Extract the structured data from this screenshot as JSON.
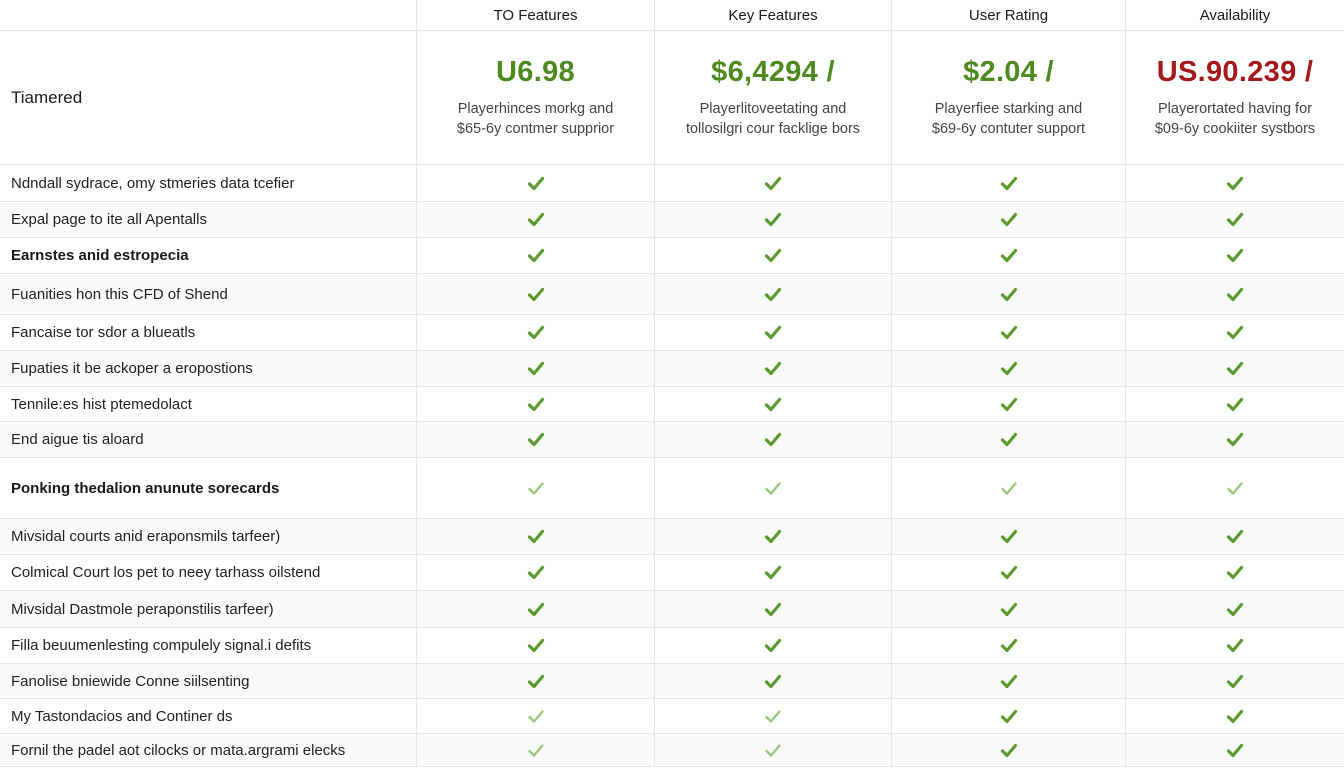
{
  "header": {
    "columns": [
      "TO Features",
      "Key Features",
      "User Rating",
      "Availability"
    ]
  },
  "plans": {
    "label": "Tiamered",
    "items": [
      {
        "price": "U6.98",
        "desc_line1": "Playerhinces morkg and",
        "desc_line2": "$65-6y contmer supprior",
        "price_color": "#4e8a1f"
      },
      {
        "price": "$6,4294 /",
        "desc_line1": "Playerlitoveetating and",
        "desc_line2": "tollosilgri cour facklige bors",
        "price_color": "#4e8a1f"
      },
      {
        "price": "$2.04 /",
        "desc_line1": "Playerfiee starking and",
        "desc_line2": "$69-6y contuter support",
        "price_color": "#4e8a1f"
      },
      {
        "price": "US.90.239 /",
        "desc_line1": "Playerortated having for",
        "desc_line2": "$09-6y cookiiter systbors",
        "price_color": "#a3191c"
      }
    ]
  },
  "check_icon": "check-icon",
  "features": [
    {
      "label": "Ndndall sydrace, omy stmeries data tcefier",
      "checks": [
        "dark",
        "dark",
        "dark",
        "dark"
      ]
    },
    {
      "label": "Expal page to ite all Apentalls",
      "checks": [
        "dark",
        "dark",
        "dark",
        "dark"
      ]
    },
    {
      "label": "Earnstes anid estropecia",
      "checks": [
        "dark",
        "dark",
        "dark",
        "dark"
      ]
    },
    {
      "label": "Fuanities hon this CFD of Shend",
      "checks": [
        "dark",
        "dark",
        "dark",
        "dark"
      ]
    },
    {
      "label": "Fancaise tor sdor a blueatls",
      "checks": [
        "dark",
        "dark",
        "dark",
        "dark"
      ]
    },
    {
      "label": "Fupaties it be ackoper a eropostions",
      "checks": [
        "dark",
        "dark",
        "dark",
        "dark"
      ]
    },
    {
      "label": "Tennile:es hist ptemedolact",
      "checks": [
        "dark",
        "dark",
        "dark",
        "dark"
      ]
    },
    {
      "label": "End aigue tis aloard",
      "checks": [
        "dark",
        "dark",
        "dark",
        "dark"
      ]
    },
    {
      "label": "Ponking thedalion anunute sorecards",
      "checks": [
        "light",
        "light",
        "light",
        "light"
      ]
    },
    {
      "label": "Mivsidal courts anid eraponsmils tarfeer)",
      "checks": [
        "dark",
        "dark",
        "dark",
        "dark"
      ]
    },
    {
      "label": "Colmical Court los pet to neey tarhass oilstend",
      "checks": [
        "dark",
        "dark",
        "dark",
        "dark"
      ]
    },
    {
      "label": "Mivsidal Dastmole peraponstilis tarfeer)",
      "checks": [
        "dark",
        "dark",
        "dark",
        "dark"
      ]
    },
    {
      "label": "Filla beuumenlesting compulely signal.i defits",
      "checks": [
        "dark",
        "dark",
        "dark",
        "dark"
      ]
    },
    {
      "label": "Fanolise bniewide Conne siilsenting",
      "checks": [
        "dark",
        "dark",
        "dark",
        "dark"
      ]
    },
    {
      "label": "My Tastondacios and Continer ds",
      "checks": [
        "light",
        "light",
        "dark",
        "dark"
      ]
    },
    {
      "label": "Fornil the padel aot cilocks or mata.argrami elecks",
      "checks": [
        "light",
        "light",
        "dark",
        "dark"
      ]
    }
  ]
}
